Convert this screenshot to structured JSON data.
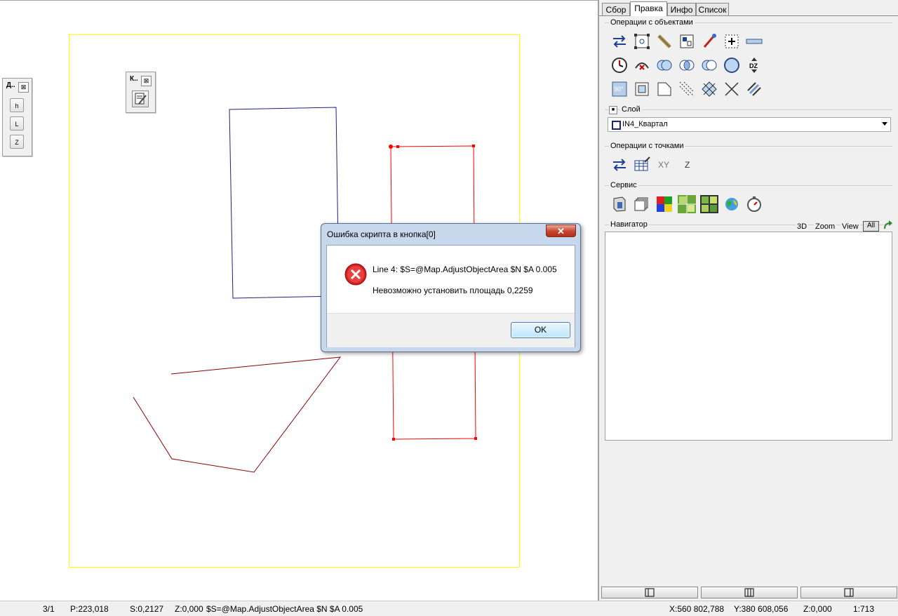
{
  "map": {
    "toolbar_d": {
      "title": "Д..",
      "close": "⊠",
      "buttons": [
        "h",
        "L",
        "Z"
      ]
    },
    "toolbar_k": {
      "title": "К..",
      "close": "⊠"
    },
    "colors": {
      "frame": "#ffff00",
      "blue_poly": "#1a237e",
      "red_poly": "#ff0000",
      "dark_red_line": "#8b0000"
    }
  },
  "panel": {
    "tabs": [
      "Сбор",
      "Правка",
      "Инфо",
      "Список"
    ],
    "active_tab": "Правка",
    "object_ops_title": "Операции с объектами",
    "layer_title": "Слой",
    "layer_value": "IN4_Квартал",
    "point_ops_title": "Операции с точками",
    "point_ops_xy": "XY",
    "point_ops_z": "Z",
    "service_title": "Сервис",
    "navigator_title": "Навигатор",
    "navigator_options": {
      "d3": "3D",
      "zoom": "Zoom",
      "view": "View",
      "all": "All"
    },
    "icons_row1": [
      "reverse-arrows-icon",
      "frame-point-icon",
      "pencil-edit-icon",
      "layout-icon",
      "brush-icon",
      "add-node-icon",
      "divide-icon"
    ],
    "icons_row2": [
      "clock-icon",
      "arc-cancel-icon",
      "union-icon",
      "intersect-icon",
      "subtract-icon",
      "circle-icon",
      "dz-icon"
    ],
    "icons_row3": [
      "rotate-90-icon",
      "inner-square-icon",
      "cut-corner-icon",
      "hatch-icon",
      "cross-hatch-icon",
      "cross-lines-icon",
      "parallel-icon"
    ],
    "point_icons": [
      "reverse-points-icon",
      "coordinates-table-icon"
    ],
    "service_icons": [
      "script-icon",
      "layers-icon",
      "color-grid-icon",
      "image-grid-1-icon",
      "image-grid-2-icon",
      "globe-icon",
      "stopwatch-icon"
    ]
  },
  "status": {
    "page": "3/1",
    "perimeter": "P:223,018",
    "area": "S:0,2127",
    "z": "Z:0,000",
    "command": "$S=@Map.AdjustObjectArea $N $A 0.005",
    "x": "X:560 802,788",
    "y": "Y:380 608,056",
    "z2": "Z:0,000",
    "scale": "1:713"
  },
  "dialog": {
    "title": "Ошибка скрипта в кнопка[0]",
    "close": "✕",
    "line1": "Line 4: $S=@Map.AdjustObjectArea $N $A 0.005",
    "line2": "Невозможно установить площадь 0,2259",
    "ok": "OK"
  }
}
